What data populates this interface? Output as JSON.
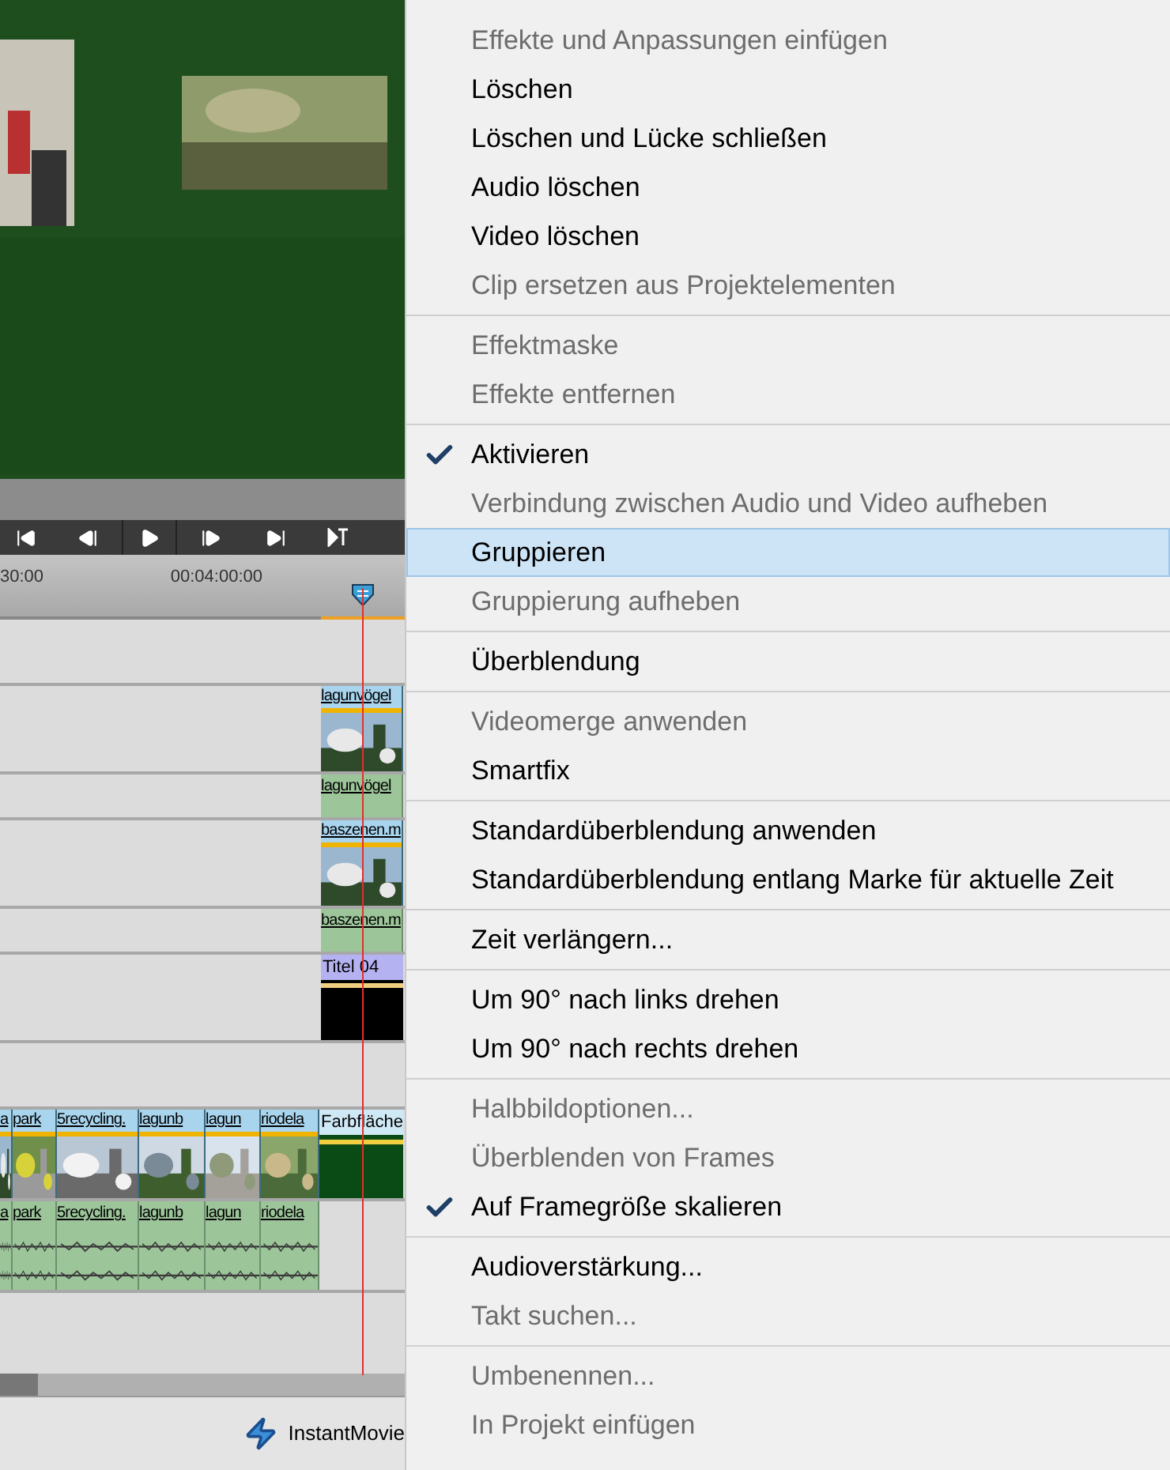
{
  "timeline": {
    "ruler_labels": [
      "30:00",
      "00:04:00:00"
    ],
    "tracks": [
      {
        "kind": "empty"
      },
      {
        "kind": "video",
        "clips": [
          {
            "label": "lagunvögel",
            "kind": "video"
          }
        ]
      },
      {
        "kind": "audio",
        "clips": [
          {
            "label": "lagunvögel",
            "kind": "audio"
          }
        ]
      },
      {
        "kind": "video",
        "clips": [
          {
            "label": "baszenen.m",
            "kind": "video"
          }
        ]
      },
      {
        "kind": "audio",
        "clips": [
          {
            "label": "baszenen.m",
            "kind": "audio"
          }
        ]
      },
      {
        "kind": "title",
        "clips": [
          {
            "label": "Titel 04",
            "kind": "title"
          }
        ]
      },
      {
        "kind": "empty"
      },
      {
        "kind": "video",
        "clips": [
          {
            "label": "a",
            "kind": "video"
          },
          {
            "label": "park",
            "kind": "video"
          },
          {
            "label": "5recycling.",
            "kind": "video"
          },
          {
            "label": "lagunb",
            "kind": "video"
          },
          {
            "label": "lagun",
            "kind": "video"
          },
          {
            "label": "riodela",
            "kind": "video"
          },
          {
            "label": "Farbfläche",
            "kind": "color"
          }
        ]
      },
      {
        "kind": "audio",
        "clips": [
          {
            "label": "a",
            "kind": "audio"
          },
          {
            "label": "park",
            "kind": "audio"
          },
          {
            "label": "5recycling.",
            "kind": "audio"
          },
          {
            "label": "lagunb",
            "kind": "audio"
          },
          {
            "label": "lagun",
            "kind": "audio"
          },
          {
            "label": "riodela",
            "kind": "audio"
          }
        ]
      }
    ]
  },
  "bottom_bar": {
    "button": "InstantMovie"
  },
  "menu": {
    "groups": [
      [
        {
          "label": "Effekte und Anpassungen einfügen",
          "disabled": true,
          "checked": false,
          "selected": false
        },
        {
          "label": "Löschen",
          "disabled": false,
          "checked": false,
          "selected": false
        },
        {
          "label": "Löschen und Lücke schließen",
          "disabled": false,
          "checked": false,
          "selected": false
        },
        {
          "label": "Audio löschen",
          "disabled": false,
          "checked": false,
          "selected": false
        },
        {
          "label": "Video löschen",
          "disabled": false,
          "checked": false,
          "selected": false
        },
        {
          "label": "Clip ersetzen aus Projektelementen",
          "disabled": true,
          "checked": false,
          "selected": false
        }
      ],
      [
        {
          "label": "Effektmaske",
          "disabled": true,
          "checked": false,
          "selected": false
        },
        {
          "label": "Effekte entfernen",
          "disabled": true,
          "checked": false,
          "selected": false
        }
      ],
      [
        {
          "label": "Aktivieren",
          "disabled": false,
          "checked": true,
          "selected": false
        },
        {
          "label": "Verbindung zwischen Audio und Video aufheben",
          "disabled": true,
          "checked": false,
          "selected": false
        },
        {
          "label": "Gruppieren",
          "disabled": false,
          "checked": false,
          "selected": true
        },
        {
          "label": "Gruppierung aufheben",
          "disabled": true,
          "checked": false,
          "selected": false
        }
      ],
      [
        {
          "label": "Überblendung",
          "disabled": false,
          "checked": false,
          "selected": false
        }
      ],
      [
        {
          "label": "Videomerge anwenden",
          "disabled": true,
          "checked": false,
          "selected": false
        },
        {
          "label": "Smartfix",
          "disabled": false,
          "checked": false,
          "selected": false
        }
      ],
      [
        {
          "label": "Standardüberblendung anwenden",
          "disabled": false,
          "checked": false,
          "selected": false
        },
        {
          "label": "Standardüberblendung entlang Marke für aktuelle Zeit",
          "disabled": false,
          "checked": false,
          "selected": false
        }
      ],
      [
        {
          "label": "Zeit verlängern...",
          "disabled": false,
          "checked": false,
          "selected": false
        }
      ],
      [
        {
          "label": "Um 90° nach links drehen",
          "disabled": false,
          "checked": false,
          "selected": false
        },
        {
          "label": "Um 90° nach rechts drehen",
          "disabled": false,
          "checked": false,
          "selected": false
        }
      ],
      [
        {
          "label": "Halbbildoptionen...",
          "disabled": true,
          "checked": false,
          "selected": false
        },
        {
          "label": "Überblenden von Frames",
          "disabled": true,
          "checked": false,
          "selected": false
        },
        {
          "label": "Auf Framegröße skalieren",
          "disabled": false,
          "checked": true,
          "selected": false
        }
      ],
      [
        {
          "label": "Audioverstärkung...",
          "disabled": false,
          "checked": false,
          "selected": false
        },
        {
          "label": "Takt suchen...",
          "disabled": true,
          "checked": false,
          "selected": false
        }
      ],
      [
        {
          "label": "Umbenennen...",
          "disabled": true,
          "checked": false,
          "selected": false
        },
        {
          "label": "In Projekt einfügen",
          "disabled": true,
          "checked": false,
          "selected": false
        }
      ]
    ]
  }
}
